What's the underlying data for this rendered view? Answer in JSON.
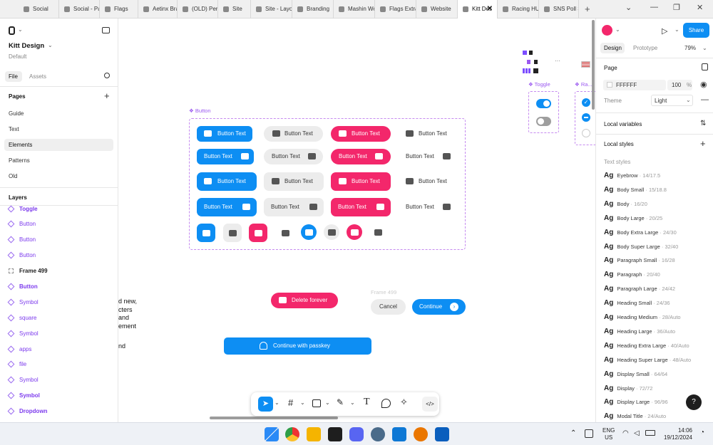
{
  "tabs": [
    {
      "label": "Social"
    },
    {
      "label": "Social - Pag"
    },
    {
      "label": "Flags"
    },
    {
      "label": "Aetinx Bran"
    },
    {
      "label": "(OLD) Perso"
    },
    {
      "label": "Site"
    },
    {
      "label": "Site - Layou"
    },
    {
      "label": "Branding"
    },
    {
      "label": "Mashin Wor"
    },
    {
      "label": "Flags Extras"
    },
    {
      "label": "Website"
    },
    {
      "label": "Kitt Des"
    },
    {
      "label": "Racing HUD"
    },
    {
      "label": "SNS Poll Sli"
    }
  ],
  "file": {
    "name": "Kitt Design",
    "subtitle": "Default"
  },
  "left_tabs": {
    "file": "File",
    "assets": "Assets"
  },
  "pages": {
    "title": "Pages",
    "items": [
      "Guide",
      "Text",
      "Elements",
      "Patterns",
      "Old"
    ]
  },
  "layers": {
    "title": "Layers",
    "items": [
      "Toggle",
      "Button",
      "Button",
      "Button",
      "Frame 499",
      "Button",
      "Symbol",
      "square",
      "Symbol",
      "apps",
      "file",
      "Symbol",
      "Symbol",
      "Dropdown"
    ]
  },
  "canvas": {
    "component_label": "Button",
    "btn_text": "Button Text",
    "delete_label": "Delete forever",
    "frame_label": "Frame 499",
    "cancel_label": "Cancel",
    "continue_label": "Continue",
    "passkey_label": "Continue with passkey",
    "toggle_label": "Toggle",
    "radio_label": "Ra...",
    "cut_text": [
      "d new,",
      "cters",
      "and",
      "ement",
      "nd"
    ]
  },
  "right": {
    "tabs": {
      "design": "Design",
      "prototype": "Prototype"
    },
    "zoom": "79%",
    "share": "Share",
    "page_label": "Page",
    "page_color": "FFFFFF",
    "page_opacity": "100",
    "pct": "%",
    "theme_label": "Theme",
    "theme_value": "Light",
    "local_variables": "Local variables",
    "local_styles": "Local styles",
    "text_styles_title": "Text styles",
    "text_styles": [
      {
        "name": "Eyebrow",
        "spec": "· 14/17.5"
      },
      {
        "name": "Body Small",
        "spec": "· 15/18.8"
      },
      {
        "name": "Body",
        "spec": "· 16/20"
      },
      {
        "name": "Body Large",
        "spec": "· 20/25"
      },
      {
        "name": "Body Extra Large",
        "spec": "· 24/30"
      },
      {
        "name": "Body Super Large",
        "spec": "· 32/40"
      },
      {
        "name": "Paragraph Small",
        "spec": "· 16/28"
      },
      {
        "name": "Paragraph",
        "spec": "· 20/40"
      },
      {
        "name": "Paragraph Large",
        "spec": "· 24/42"
      },
      {
        "name": "Heading Small",
        "spec": "· 24/36"
      },
      {
        "name": "Heading Medium",
        "spec": "· 28/Auto"
      },
      {
        "name": "Heading Large",
        "spec": "· 36/Auto"
      },
      {
        "name": "Heading Extra Large",
        "spec": "· 40/Auto"
      },
      {
        "name": "Heading Super Large",
        "spec": "· 48/Auto"
      },
      {
        "name": "Display Small",
        "spec": "· 64/64"
      },
      {
        "name": "Display",
        "spec": "· 72/72"
      },
      {
        "name": "Display Large",
        "spec": "· 96/96"
      },
      {
        "name": "Modal Title",
        "spec": "· 24/Auto"
      }
    ],
    "ag": "Ag",
    "help": "?"
  },
  "taskbar": {
    "lang1": "ENG",
    "lang2": "US",
    "time": "14:06",
    "date": "19/12/2024"
  },
  "colors": {
    "blue": "#0d8ef3",
    "pink": "#f3276b",
    "purple": "#9b59f0",
    "share": "#0d8ef3"
  }
}
